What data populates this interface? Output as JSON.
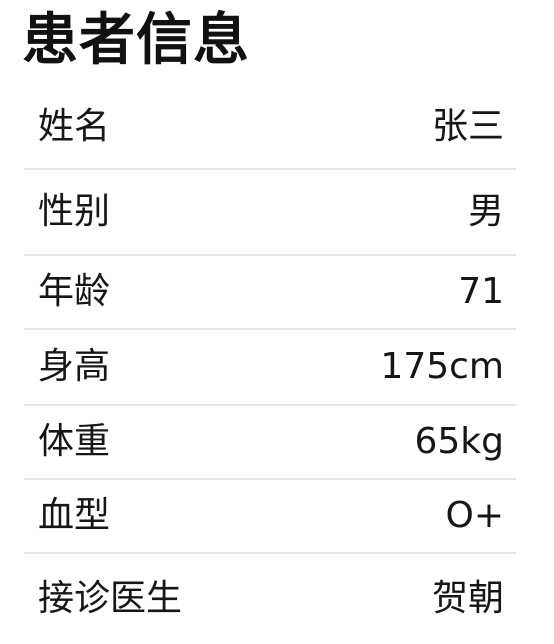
{
  "page": {
    "title": "患者信息"
  },
  "patient_info": [
    {
      "label": "姓名",
      "value": "张三"
    },
    {
      "label": "性别",
      "value": "男"
    },
    {
      "label": "年龄",
      "value": "71"
    },
    {
      "label": "身高",
      "value": "175cm"
    },
    {
      "label": "体重",
      "value": "65kg"
    },
    {
      "label": "血型",
      "value": "O+"
    },
    {
      "label": "接诊医生",
      "value": "贺朝"
    }
  ]
}
